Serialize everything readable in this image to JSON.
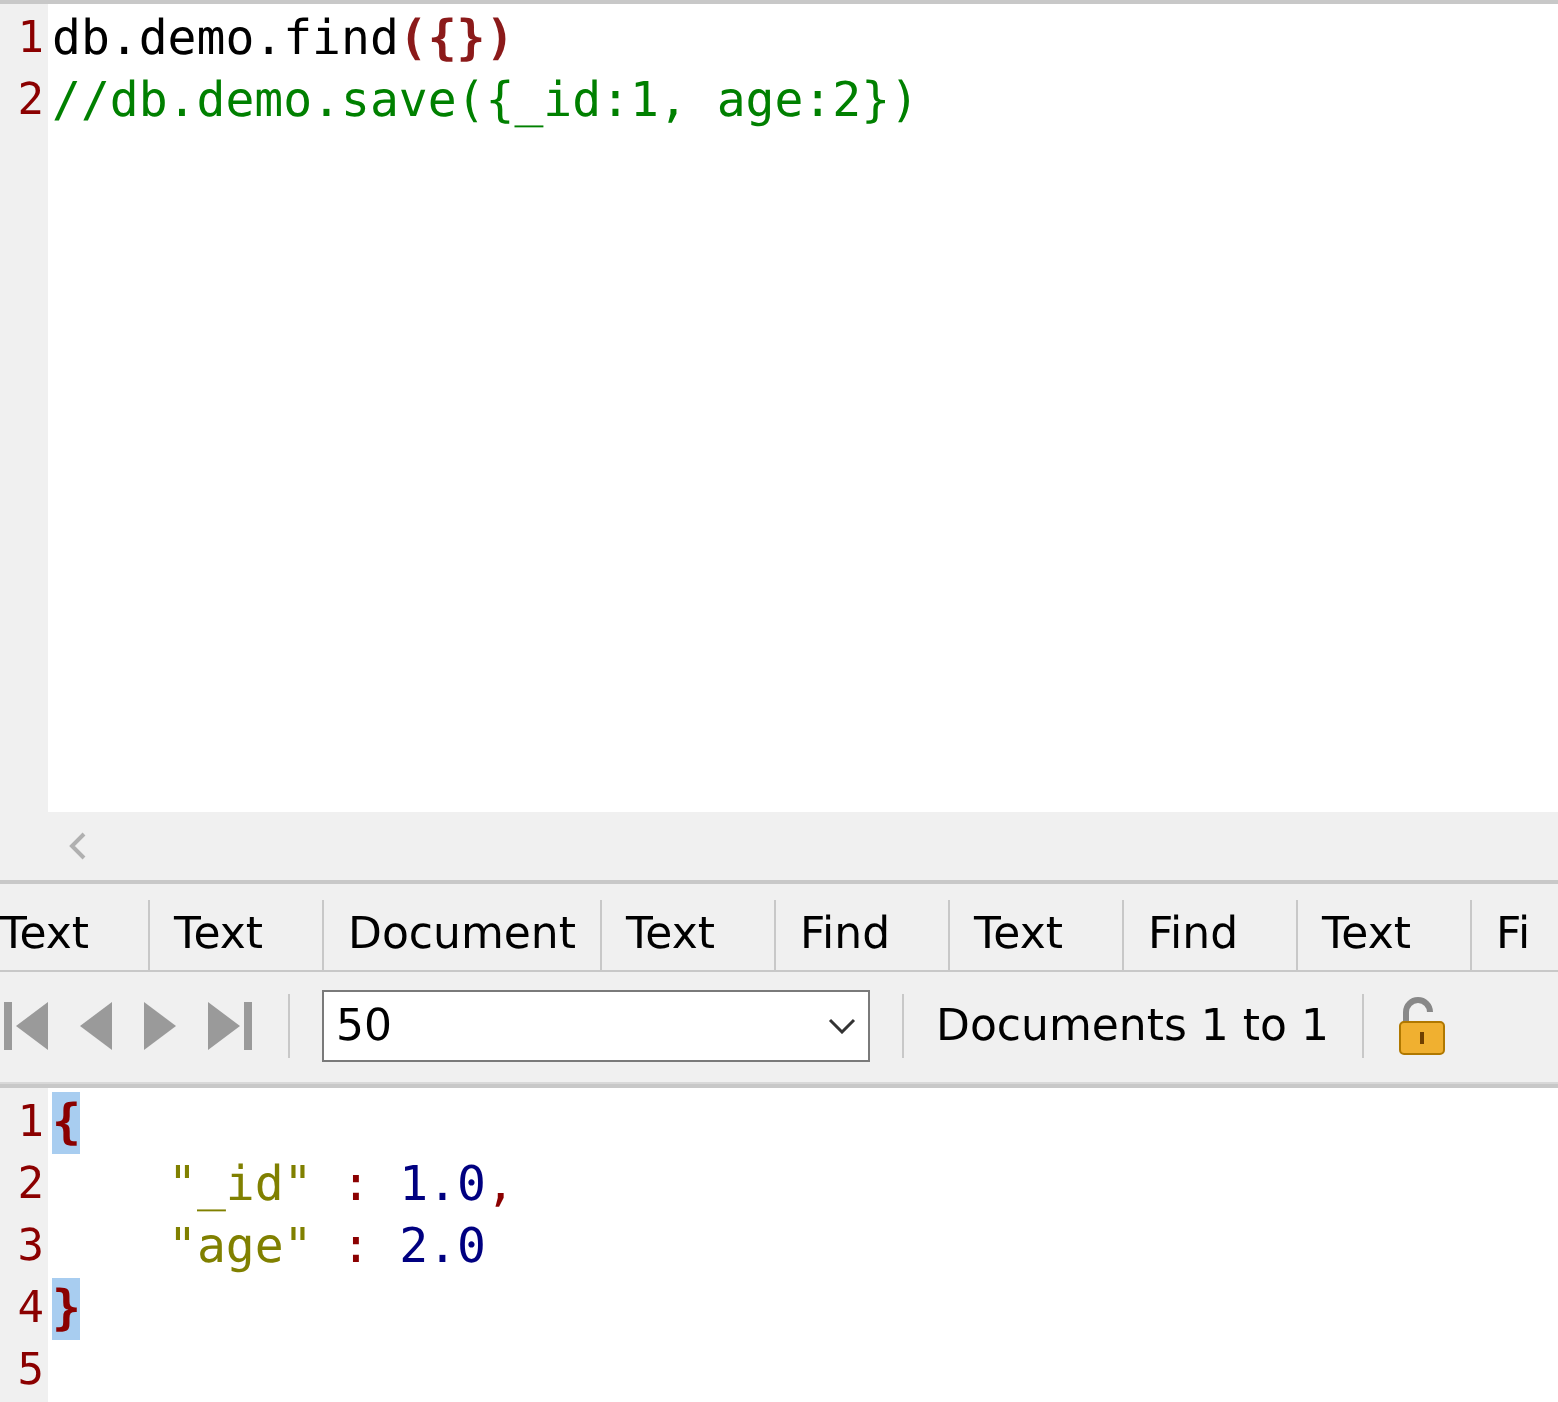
{
  "editor": {
    "lines": [
      {
        "number": "1",
        "tokens": [
          {
            "kind": "plain",
            "text": "db.demo.find"
          },
          {
            "kind": "paren",
            "text": "({})"
          }
        ]
      },
      {
        "number": "2",
        "tokens": [
          {
            "kind": "comment",
            "text": "//db.demo.save({_id:1, age:2})"
          }
        ]
      }
    ]
  },
  "result_tabs": [
    {
      "label": "Text",
      "selected": false
    },
    {
      "label": "Text",
      "selected": false
    },
    {
      "label": "Document",
      "selected": false
    },
    {
      "label": "Text",
      "selected": false
    },
    {
      "label": "Find",
      "selected": false
    },
    {
      "label": "Text",
      "selected": false
    },
    {
      "label": "Find",
      "selected": false
    },
    {
      "label": "Text",
      "selected": false
    },
    {
      "label": "Fi",
      "selected": false
    }
  ],
  "toolbar": {
    "page_size": "50",
    "documents_label": "Documents 1 to 1"
  },
  "result": {
    "lines": [
      {
        "number": "1",
        "tokens": [
          {
            "kind": "matched-brace",
            "text": "{"
          }
        ]
      },
      {
        "number": "2",
        "indented": true,
        "tokens": [
          {
            "kind": "key",
            "text": "\"_id\""
          },
          {
            "kind": "punct",
            "text": " : "
          },
          {
            "kind": "number",
            "text": "1.0"
          },
          {
            "kind": "punct",
            "text": ","
          }
        ]
      },
      {
        "number": "3",
        "indented": true,
        "tokens": [
          {
            "kind": "key",
            "text": "\"age\""
          },
          {
            "kind": "punct",
            "text": " : "
          },
          {
            "kind": "number",
            "text": "2.0"
          }
        ]
      },
      {
        "number": "4",
        "tokens": [
          {
            "kind": "matched-brace",
            "text": "}"
          }
        ]
      },
      {
        "number": "5"
      }
    ]
  }
}
